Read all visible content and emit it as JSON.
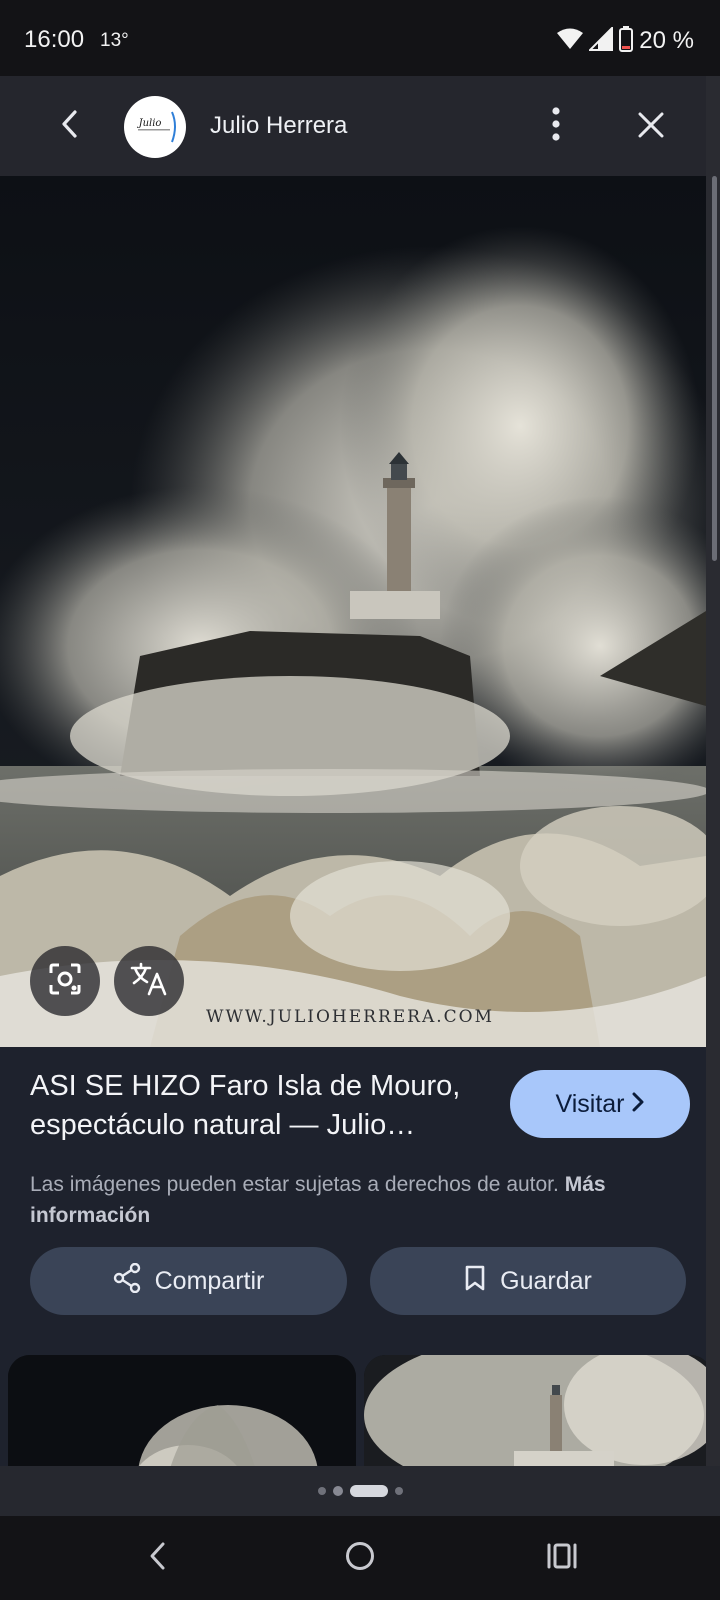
{
  "status_bar": {
    "time": "16:00",
    "temperature": "13°",
    "battery": "20 %",
    "battery_level": 0.2
  },
  "header": {
    "source_name": "Julio Herrera",
    "avatar_text": "Julio Herrera"
  },
  "image": {
    "watermark": "WWW.JULIOHERRERA.COM"
  },
  "result": {
    "title": "ASI SE HIZO Faro Isla de Mouro, espectáculo natural — Julio…",
    "visit_label": "Visitar",
    "copyright_text": "Las imágenes pueden estar sujetas a derechos de autor.",
    "more_info_label": "Más información"
  },
  "actions": {
    "share_label": "Compartir",
    "save_label": "Guardar"
  },
  "pager": {
    "count": 4,
    "active_index": 2
  },
  "colors": {
    "accent": "#a8c7fa",
    "button_bg": "#3a4457",
    "panel_bg": "#1e222d"
  }
}
